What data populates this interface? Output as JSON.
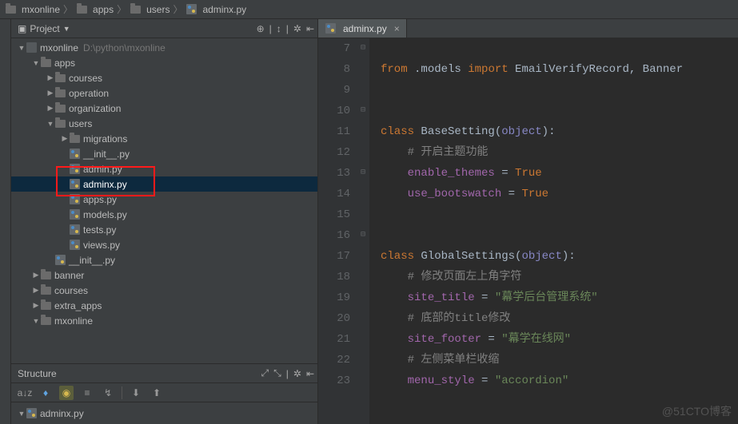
{
  "breadcrumbs": [
    {
      "label": "mxonline",
      "icon": "folder"
    },
    {
      "label": "apps",
      "icon": "folder"
    },
    {
      "label": "users",
      "icon": "folder"
    },
    {
      "label": "adminx.py",
      "icon": "py"
    }
  ],
  "project_panel": {
    "title": "Project",
    "root": {
      "label": "mxonline",
      "path": "D:\\python\\mxonline"
    },
    "tree": [
      {
        "depth": 0,
        "expanded": true,
        "icon": "mod",
        "label": "mxonline",
        "extra": "D:\\python\\mxonline"
      },
      {
        "depth": 1,
        "expanded": true,
        "icon": "folder",
        "label": "apps"
      },
      {
        "depth": 2,
        "expanded": false,
        "icon": "folder",
        "label": "courses"
      },
      {
        "depth": 2,
        "expanded": false,
        "icon": "folder",
        "label": "operation"
      },
      {
        "depth": 2,
        "expanded": false,
        "icon": "folder",
        "label": "organization"
      },
      {
        "depth": 2,
        "expanded": true,
        "icon": "folder",
        "label": "users"
      },
      {
        "depth": 3,
        "expanded": false,
        "icon": "folder",
        "label": "migrations"
      },
      {
        "depth": 3,
        "icon": "py",
        "label": "__init__.py"
      },
      {
        "depth": 3,
        "icon": "py",
        "label": "admin.py"
      },
      {
        "depth": 3,
        "icon": "py",
        "label": "adminx.py",
        "selected": true,
        "boxed": true
      },
      {
        "depth": 3,
        "icon": "py",
        "label": "apps.py"
      },
      {
        "depth": 3,
        "icon": "py",
        "label": "models.py"
      },
      {
        "depth": 3,
        "icon": "py",
        "label": "tests.py"
      },
      {
        "depth": 3,
        "icon": "py",
        "label": "views.py"
      },
      {
        "depth": 2,
        "icon": "py",
        "label": "__init__.py"
      },
      {
        "depth": 1,
        "expanded": false,
        "icon": "folder",
        "label": "banner"
      },
      {
        "depth": 1,
        "expanded": false,
        "icon": "folder",
        "label": "courses"
      },
      {
        "depth": 1,
        "expanded": false,
        "icon": "folder",
        "label": "extra_apps"
      },
      {
        "depth": 1,
        "expanded": true,
        "icon": "folder",
        "label": "mxonline",
        "cut": true
      }
    ]
  },
  "structure_panel": {
    "title": "Structure",
    "file": "adminx.py"
  },
  "editor": {
    "tab": {
      "label": "adminx.py"
    },
    "first_line": 7,
    "lines": [
      {
        "n": 7,
        "html": ""
      },
      {
        "n": 8,
        "fold": "-",
        "html": "<span class='kw'>from</span> .models <span class='kw'>import</span> EmailVerifyRecord, Banner"
      },
      {
        "n": 9,
        "html": ""
      },
      {
        "n": 10,
        "html": ""
      },
      {
        "n": 11,
        "fold": "-",
        "html": "<span class='kw'>class</span> <span class='cls'>BaseSetting</span>(<span class='builtin'>object</span>):"
      },
      {
        "n": 12,
        "html": "    <span class='cmt'># 开启主题功能</span>"
      },
      {
        "n": 13,
        "html": "    <span class='ident'>enable_themes</span> = <span class='kw'>True</span>"
      },
      {
        "n": 14,
        "fold": "-",
        "html": "    <span class='ident'>use_bootswatch</span> = <span class='kw'>True</span>"
      },
      {
        "n": 15,
        "html": ""
      },
      {
        "n": 16,
        "html": ""
      },
      {
        "n": 17,
        "fold": "-",
        "html": "<span class='kw'>class</span> <span class='cls'>GlobalSettings</span>(<span class='builtin'>object</span>):"
      },
      {
        "n": 18,
        "html": "    <span class='cmt'># 修改页面左上角字符</span>"
      },
      {
        "n": 19,
        "html": "    <span class='ident'>site_title</span> = <span class='str'>\"幕学后台管理系统\"</span>"
      },
      {
        "n": 20,
        "html": "    <span class='cmt'># 底部的title修改</span>"
      },
      {
        "n": 21,
        "html": "    <span class='ident'>site_footer</span> = <span class='str'>\"幕学在线网\"</span>"
      },
      {
        "n": 22,
        "html": "    <span class='cmt'># 左侧菜单栏收缩</span>"
      },
      {
        "n": 23,
        "html": "    <span class='ident'>menu_style</span> = <span class='str'>\"accordion\"</span>"
      }
    ]
  },
  "watermark": "@51CTO博客"
}
